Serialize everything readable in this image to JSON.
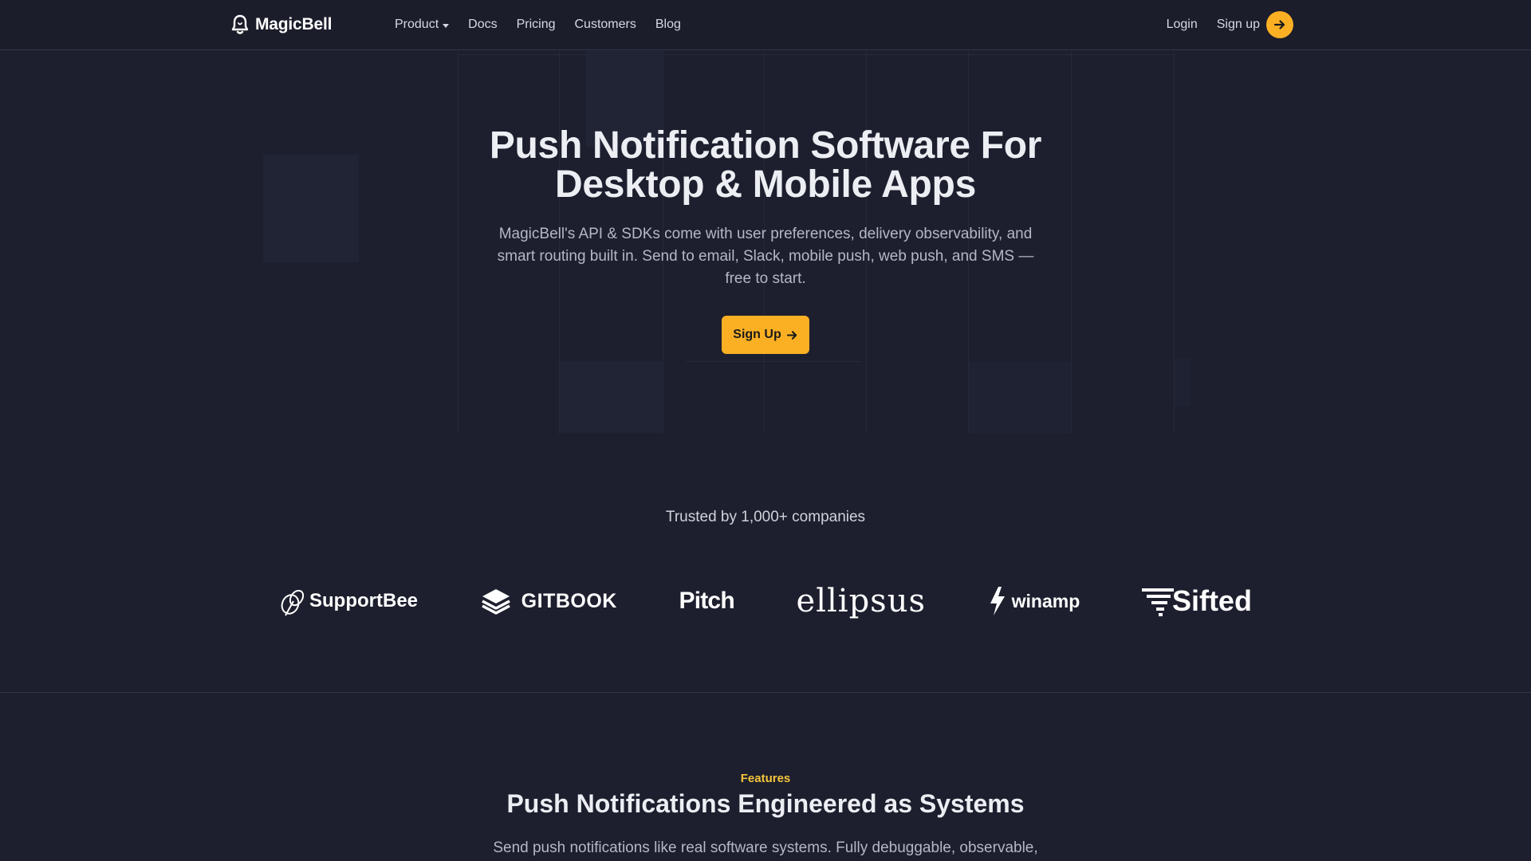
{
  "nav": {
    "brand": "MagicBell",
    "links": [
      {
        "label": "Product",
        "has_dropdown": true
      },
      {
        "label": "Docs"
      },
      {
        "label": "Pricing"
      },
      {
        "label": "Customers"
      },
      {
        "label": "Blog"
      }
    ],
    "login": "Login",
    "signup": "Sign up"
  },
  "hero": {
    "title_line1": "Push Notification Software For",
    "title_line2": "Desktop & Mobile Apps",
    "subtitle_line1": "MagicBell's API & SDKs come with user preferences, delivery observability, and",
    "subtitle_line2": "smart routing built in. Send to email, Slack, mobile push, web push, and SMS —",
    "subtitle_line3": "free to start.",
    "cta": "Sign Up"
  },
  "trusted": {
    "heading": "Trusted by 1,000+ companies",
    "logos": [
      "SupportBee",
      "GITBOOK",
      "Pitch",
      "ellipsus",
      "winamp",
      "Sifted"
    ]
  },
  "features": {
    "eyebrow": "Features",
    "title": "Push Notifications Engineered as Systems",
    "subtitle": "Send push notifications like real software systems. Fully debuggable, observable,"
  },
  "colors": {
    "background": "#1d1f2e",
    "accent": "#fbb024",
    "eyebrow": "#f4c53a"
  },
  "icons": {
    "brand": "bell-icon",
    "signup": "arrow-right-icon",
    "cta": "arrow-right-icon"
  }
}
